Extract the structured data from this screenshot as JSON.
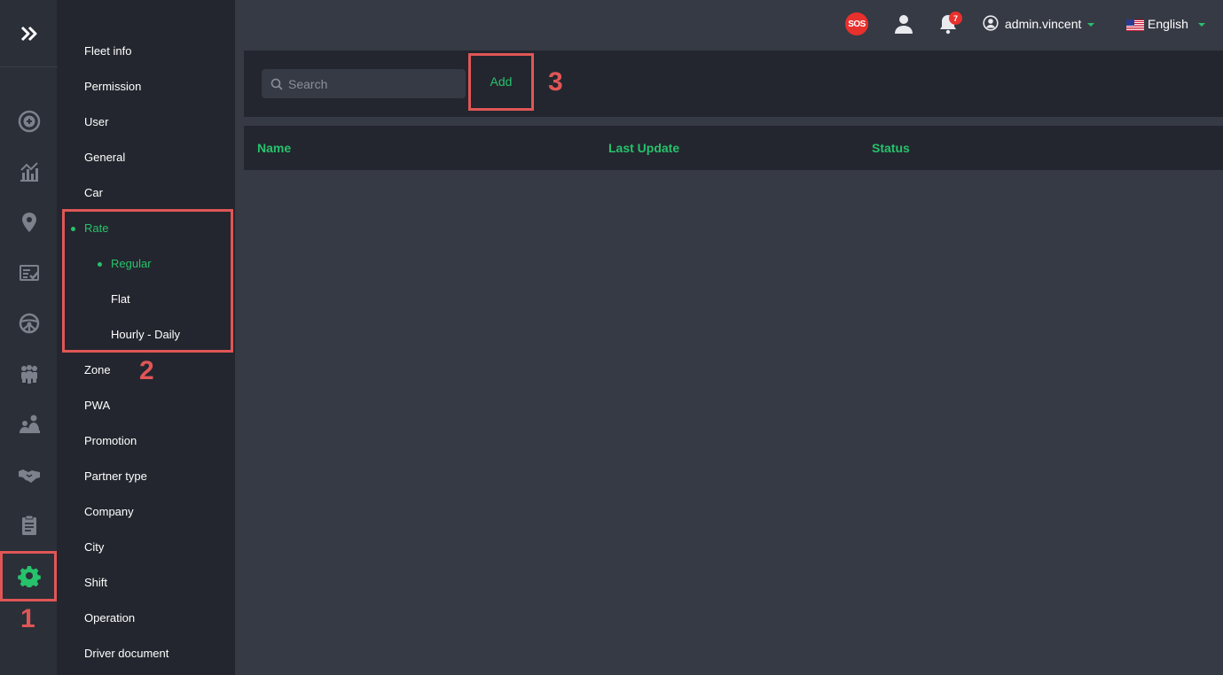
{
  "header": {
    "sos_label": "SOS",
    "notification_count": "7",
    "user_name": "admin.vincent",
    "language": "English"
  },
  "rail": {
    "icons": [
      "expand-icon",
      "plus-circle-icon",
      "chart-icon",
      "location-pin-icon",
      "checklist-icon",
      "steering-wheel-icon",
      "users-group-icon",
      "user-meeting-icon",
      "handshake-icon",
      "clipboard-icon",
      "gear-icon"
    ]
  },
  "menu": {
    "items": [
      {
        "label": "Fleet info"
      },
      {
        "label": "Permission"
      },
      {
        "label": "User"
      },
      {
        "label": "General"
      },
      {
        "label": "Car"
      },
      {
        "label": "Rate"
      },
      {
        "label": "Regular"
      },
      {
        "label": "Flat"
      },
      {
        "label": "Hourly - Daily"
      },
      {
        "label": "Zone"
      },
      {
        "label": "PWA"
      },
      {
        "label": "Promotion"
      },
      {
        "label": "Partner type"
      },
      {
        "label": "Company"
      },
      {
        "label": "City"
      },
      {
        "label": "Shift"
      },
      {
        "label": "Operation"
      },
      {
        "label": "Driver document"
      }
    ]
  },
  "toolbar": {
    "search_placeholder": "Search",
    "add_label": "Add"
  },
  "table": {
    "columns": [
      "Name",
      "Last Update",
      "Status"
    ]
  },
  "annotations": {
    "step1": "1",
    "step2": "2",
    "step3": "3"
  },
  "colors": {
    "accent": "#27c26c",
    "annotation": "#e05656",
    "badge": "#e8302d"
  }
}
